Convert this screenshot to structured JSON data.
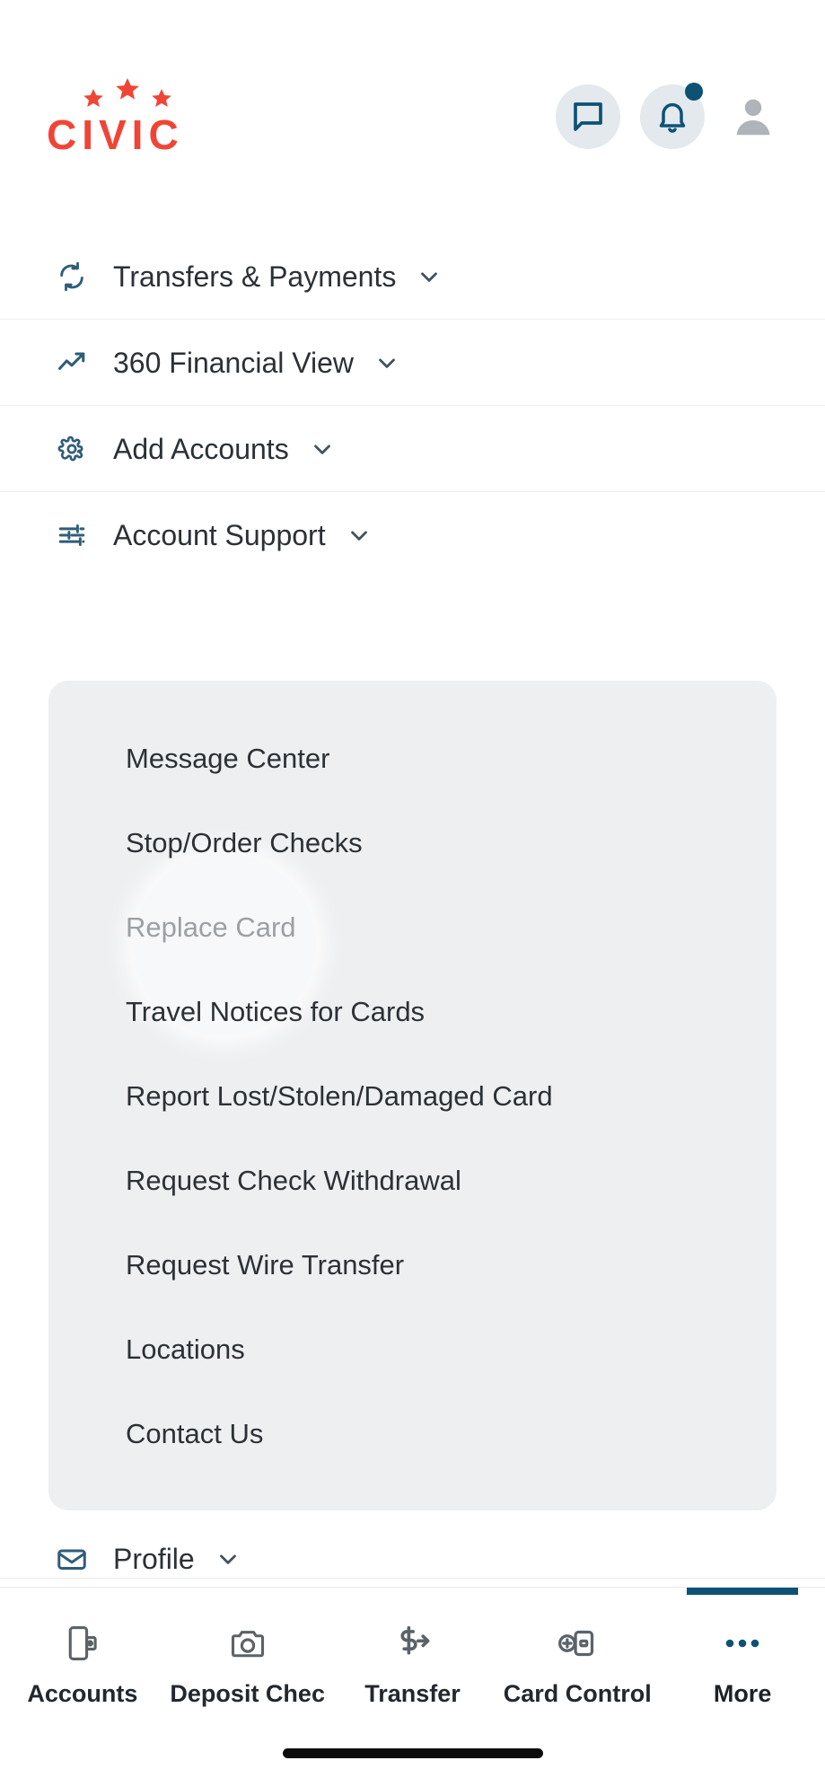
{
  "brand": {
    "name": "CIVIC",
    "logo_color": "#F04536",
    "accent_color": "#0d5275",
    "star_count": 3
  },
  "header": {
    "chat_icon": "chat-bubble-icon",
    "bell_icon": "bell-icon",
    "avatar_icon": "person-avatar-icon",
    "has_notification": true
  },
  "nav": {
    "items": [
      {
        "label": "Transfers & Payments",
        "icon": "sync-arrows-icon",
        "chevron": "chevron-down-icon",
        "expanded": false
      },
      {
        "label": "360 Financial View",
        "icon": "trending-up-icon",
        "chevron": "chevron-down-icon",
        "expanded": false
      },
      {
        "label": "Add Accounts",
        "icon": "gear-icon",
        "chevron": "chevron-down-icon",
        "expanded": false
      },
      {
        "label": "Account Support",
        "icon": "sliders-tune-icon",
        "chevron": "chevron-down-icon",
        "expanded": true
      }
    ]
  },
  "submenu": {
    "parent": "Account Support",
    "pressed_item": "Replace Card",
    "items": [
      {
        "label": "Message Center"
      },
      {
        "label": "Stop/Order Checks"
      },
      {
        "label": "Replace Card"
      },
      {
        "label": "Travel Notices for Cards"
      },
      {
        "label": "Report Lost/Stolen/Damaged Card"
      },
      {
        "label": "Request Check Withdrawal"
      },
      {
        "label": "Request Wire Transfer"
      },
      {
        "label": "Locations"
      },
      {
        "label": "Contact Us"
      }
    ]
  },
  "profile": {
    "label": "Profile",
    "icon": "envelope-icon",
    "chevron": "chevron-down-icon"
  },
  "tabbar": {
    "active": "More",
    "items": [
      {
        "label": "Accounts",
        "icon": "phone-wallet-icon",
        "active": false
      },
      {
        "label": "Deposit Chec",
        "icon": "camera-icon",
        "active": false
      },
      {
        "label": "Transfer",
        "icon": "dollar-arrow-icon",
        "active": false
      },
      {
        "label": "Card Control",
        "icon": "card-plus-icon",
        "active": false
      },
      {
        "label": "More",
        "icon": "ellipsis-icon",
        "active": true
      }
    ]
  }
}
